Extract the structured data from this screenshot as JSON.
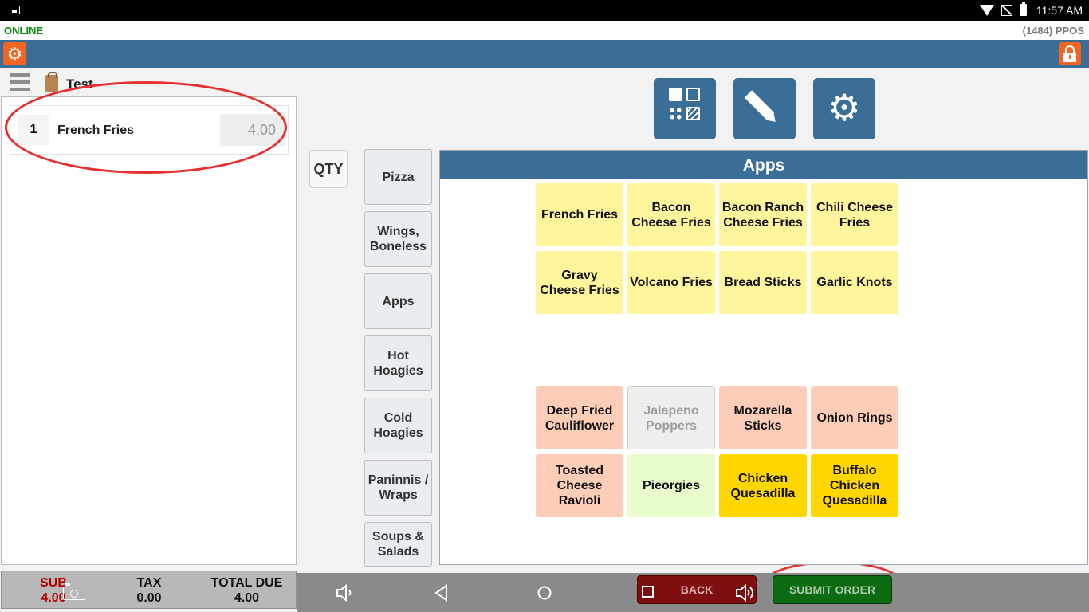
{
  "status_bar": {
    "time": "11:57 AM"
  },
  "connection": {
    "status": "ONLINE",
    "device": "(1484) PPOS"
  },
  "order": {
    "title": "Test",
    "lines": [
      {
        "qty": "1",
        "name": "French Fries",
        "price": "4.00"
      }
    ]
  },
  "totals": {
    "sub_label": "SUB",
    "sub_value": "4.00",
    "tax_label": "TAX",
    "tax_value": "0.00",
    "total_label": "TOTAL DUE",
    "total_value": "4.00"
  },
  "qty_label": "QTY",
  "categories": [
    "Pizza",
    "Wings, Boneless",
    "Apps",
    "Hot Hoagies",
    "Cold Hoagies",
    "Paninnis / Wraps",
    "Soups & Salads"
  ],
  "menu": {
    "title": "Apps",
    "items": [
      "French Fries",
      "Bacon Cheese Fries",
      "Bacon Ranch Cheese Fries",
      "Chili Cheese Fries",
      "Gravy Cheese Fries",
      "Volcano Fries",
      "Bread Sticks",
      "Garlic Knots",
      "Deep Fried Cauliflower",
      "Jalapeno Poppers",
      "Mozarella Sticks",
      "Onion Rings",
      "Toasted Cheese Ravioli",
      "Pieorgies",
      "Chicken Quesadilla",
      "Buffalo Chicken Quesadilla"
    ]
  },
  "buttons": {
    "back": "BACK",
    "submit": "SUBMIT ORDER"
  },
  "colors": {
    "brand_blue": "#3a6e96",
    "accent_orange": "#f26522",
    "item_yellow": "#fff59d",
    "item_salmon": "#fdcdb8",
    "item_disabled": "#eeeeee",
    "item_lightgreen": "#e8fccc",
    "item_gold": "#ffd600",
    "back_red": "#7d0f10",
    "submit_green": "#0c6a12"
  }
}
